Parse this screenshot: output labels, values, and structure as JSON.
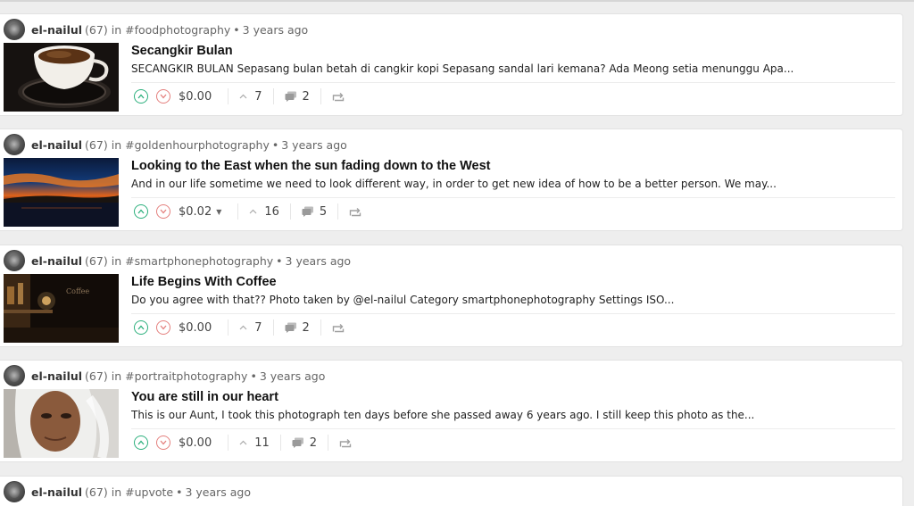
{
  "colors": {
    "upvote": "#2db07d",
    "downvote": "#e4807e",
    "background": "#eeeeee"
  },
  "icons": {
    "upvote": "chevron-up-circle-icon",
    "downvote": "chevron-down-circle-icon",
    "votes": "chevron-up-icon",
    "comments": "comments-icon",
    "reblog": "reblog-icon",
    "payout_dropdown": "caret-down-icon"
  },
  "posts": [
    {
      "author": "el-nailul",
      "reputation": "(67)",
      "in": "in",
      "tag": "#foodphotography",
      "dot": "•",
      "time": "3 years ago",
      "title": "Secangkir Bulan",
      "excerpt": "SECANGKIR BULAN Sepasang bulan betah di cangkir kopi Sepasang sandal lari kemana? Ada Meong setia menunggu Apa...",
      "payout": "$0.00",
      "votes": "7",
      "comments": "2"
    },
    {
      "author": "el-nailul",
      "reputation": "(67)",
      "in": "in",
      "tag": "#goldenhourphotography",
      "dot": "•",
      "time": "3 years ago",
      "title": "Looking to the East when the sun fading down to the West",
      "excerpt": "And in our life sometime we need to look different way, in order to get new idea of how to be a better person. We may...",
      "payout": "$0.02",
      "votes": "16",
      "comments": "5"
    },
    {
      "author": "el-nailul",
      "reputation": "(67)",
      "in": "in",
      "tag": "#smartphonephotography",
      "dot": "•",
      "time": "3 years ago",
      "title": "Life Begins With Coffee",
      "excerpt": "Do you agree with that?? Photo taken by @el-nailul Category smartphonephotography Settings ISO...",
      "payout": "$0.00",
      "votes": "7",
      "comments": "2"
    },
    {
      "author": "el-nailul",
      "reputation": "(67)",
      "in": "in",
      "tag": "#portraitphotography",
      "dot": "•",
      "time": "3 years ago",
      "title": "You are still in our heart",
      "excerpt": "This is our Aunt, I took this photograph ten days before she passed away 6 years ago. I still keep this photo as the...",
      "payout": "$0.00",
      "votes": "11",
      "comments": "2"
    },
    {
      "author": "el-nailul",
      "reputation": "(67)",
      "in": "in",
      "tag": "#upvote",
      "dot": "•",
      "time": "3 years ago"
    }
  ]
}
